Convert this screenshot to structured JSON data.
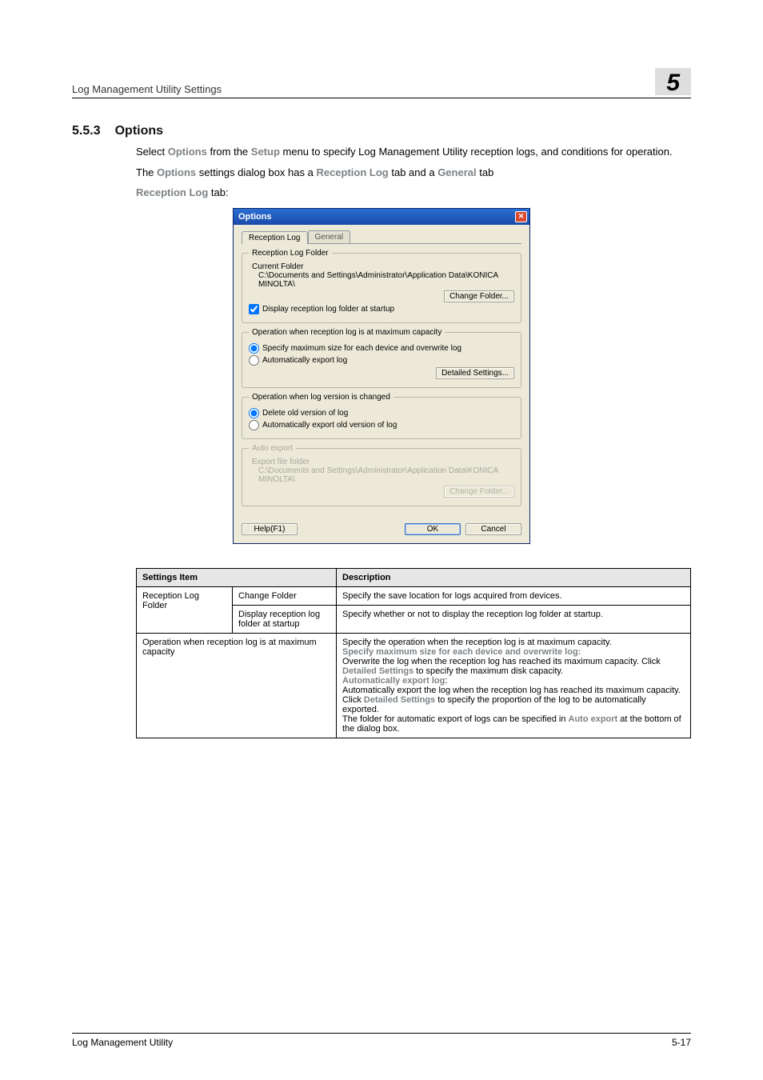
{
  "header": {
    "title": "Log Management Utility Settings",
    "badge": "5"
  },
  "section": {
    "number": "5.5.3",
    "title": "Options"
  },
  "body": {
    "p1_a": "Select ",
    "p1_b": "Options",
    "p1_c": " from the ",
    "p1_d": "Setup",
    "p1_e": " menu to specify Log Management Utility reception logs, and conditions for operation.",
    "p2_a": "The ",
    "p2_b": "Options",
    "p2_c": " settings dialog box has a ",
    "p2_d": "Reception Log",
    "p2_e": " tab and a ",
    "p2_f": "General",
    "p2_g": " tab",
    "p3_a": "Reception Log",
    "p3_b": " tab:"
  },
  "dialog": {
    "title": "Options",
    "tab_active": "Reception Log",
    "tab_inactive": "General",
    "group1": {
      "legend": "Reception Log Folder",
      "current_label": "Current Folder",
      "current_path": "C:\\Documents and Settings\\Administrator\\Application Data\\KONICA MINOLTA\\",
      "change_btn": "Change Folder...",
      "chk_label": "Display reception log folder at startup"
    },
    "group2": {
      "legend": "Operation when reception log is at maximum capacity",
      "opt1": "Specify maximum size for each device and overwrite log",
      "opt2": "Automatically export log",
      "btn": "Detailed Settings..."
    },
    "group3": {
      "legend": "Operation when log version is changed",
      "opt1": "Delete old version of log",
      "opt2": "Automatically export old version of log"
    },
    "group4": {
      "legend": "Auto export",
      "label": "Export file folder",
      "path": "C:\\Documents and Settings\\Administrator\\Application Data\\KONICA MINOLTA\\",
      "btn": "Change Folder..."
    },
    "bottom": {
      "help": "Help(F1)",
      "ok": "OK",
      "cancel": "Cancel"
    }
  },
  "table": {
    "head_item": "Settings Item",
    "head_desc": "Description",
    "r1c1": "Reception Log Folder",
    "r1c2": "Change Folder",
    "r1c3": "Specify the save location for logs acquired from devices.",
    "r2c2": "Display reception log folder at startup",
    "r2c3": "Specify whether or not to display the reception log folder at startup.",
    "r3c1": "Operation when reception log is at maximum capacity",
    "r3c3_a": "Specify the operation when the reception log is at maximum capacity.",
    "r3c3_b": "Specify maximum size for each device and overwrite log",
    "r3c3_c": ":",
    "r3c3_d": "Overwrite the log when the reception log has reached its maximum capacity. Click ",
    "r3c3_e": "Detailed Settings",
    "r3c3_f": " to specify the maximum disk capacity.",
    "r3c3_g": "Automatically export log",
    "r3c3_h": ":",
    "r3c3_i": "Automatically export the log when the reception log has reached its maximum capacity. Click ",
    "r3c3_j": "Detailed Settings",
    "r3c3_k": " to specify the proportion of the log to be automatically exported.",
    "r3c3_l": "The folder for automatic export of logs can be specified in ",
    "r3c3_m": "Auto export",
    "r3c3_n": " at the bottom of the dialog box."
  },
  "footer": {
    "left": "Log Management Utility",
    "right": "5-17"
  }
}
